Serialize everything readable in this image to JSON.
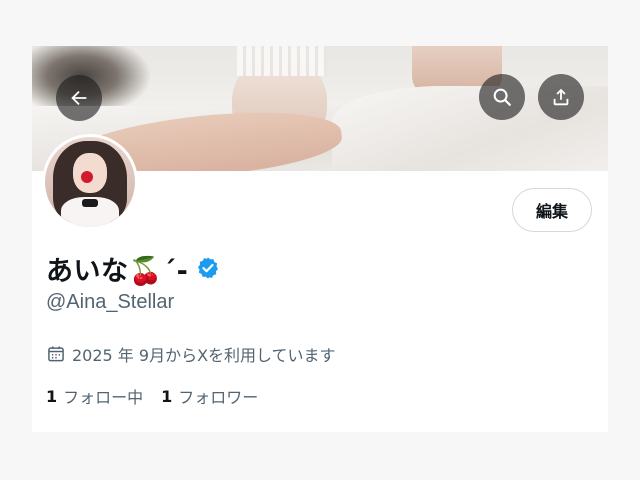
{
  "header": {
    "back_label": "Back",
    "search_label": "Search",
    "share_label": "Share"
  },
  "profile": {
    "display_name": "あいな🍒´-",
    "handle": "@Aina_Stellar",
    "joined": "2025 年 9月からXを利用しています",
    "edit_label": "編集",
    "verified": true,
    "verified_color": "#1d9bf0"
  },
  "stats": {
    "following_count": "1",
    "following_label": "フォロー中",
    "followers_count": "1",
    "followers_label": "フォロワー"
  },
  "icons": {
    "back": "arrow-left-icon",
    "search": "search-icon",
    "share": "share-icon",
    "calendar": "calendar-icon",
    "verified": "verified-badge-icon"
  }
}
